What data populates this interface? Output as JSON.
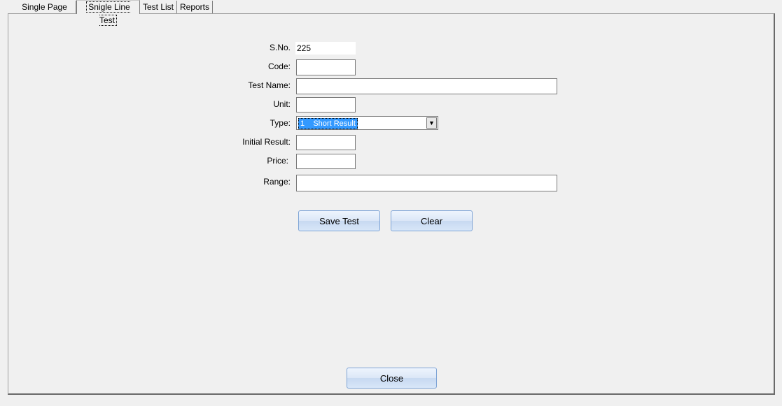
{
  "tabs": [
    {
      "label": "Single Page Test",
      "selected": false
    },
    {
      "label": "Snigle Line Test",
      "selected": true
    },
    {
      "label": "Test List",
      "selected": false
    },
    {
      "label": "Reports",
      "selected": false
    }
  ],
  "form": {
    "sno": {
      "label": "S.No.",
      "value": "225"
    },
    "code": {
      "label": "Code:",
      "value": ""
    },
    "test_name": {
      "label": "Test Name:",
      "value": ""
    },
    "unit": {
      "label": "Unit:",
      "value": ""
    },
    "type": {
      "label": "Type:",
      "value": "1    Short Result"
    },
    "initial_result": {
      "label": "Initial Result:",
      "value": ""
    },
    "price": {
      "label": "Price:",
      "value": ""
    },
    "range": {
      "label": "Range:",
      "value": ""
    }
  },
  "buttons": {
    "save": "Save Test",
    "clear": "Clear",
    "close": "Close"
  }
}
